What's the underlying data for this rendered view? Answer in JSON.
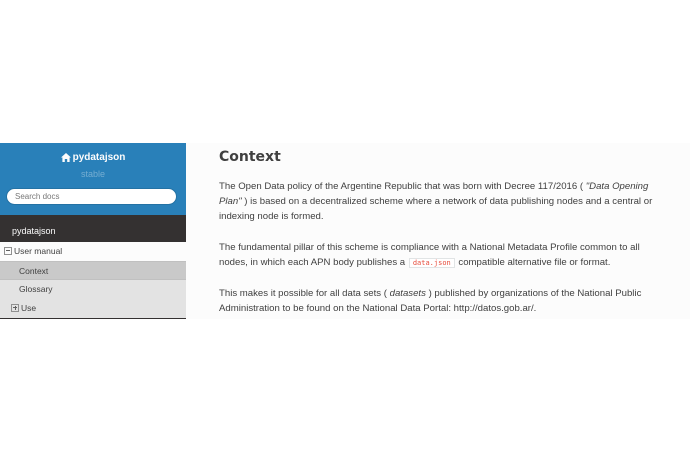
{
  "sidebar": {
    "project_name": "pydatajson",
    "version": "stable",
    "search_placeholder": "Search docs",
    "caption": "pydatajson",
    "items": [
      {
        "label": "User manual"
      },
      {
        "label": "Context"
      },
      {
        "label": "Glossary"
      },
      {
        "label": "Use"
      }
    ]
  },
  "main": {
    "title": "Context",
    "p1": {
      "a": "The Open Data policy of the Argentine Republic that was born with Decree 117/2016 ( ",
      "em": "\"Data Opening Plan\"",
      "b": " ) is based on a decentralized scheme where a network of data publishing nodes and a central or indexing node is formed."
    },
    "p2": {
      "a": "The fundamental pillar of this scheme is compliance with a National Metadata Profile common to all nodes, in which each APN body publishes a ",
      "code": "data.json",
      "b": " compatible alternative file or format."
    },
    "p3": {
      "a": "This makes it possible for all data sets ( ",
      "em": "datasets",
      "b": " ) published by organizations of the National Public Administration to be found on the National Data Portal: http://datos.gob.ar/."
    }
  },
  "colors": {
    "sidebar_header": "#2980b9",
    "sidebar_bg": "#343131",
    "content_bg": "#fcfcfc",
    "text": "#404040",
    "code": "#e74c3c"
  }
}
